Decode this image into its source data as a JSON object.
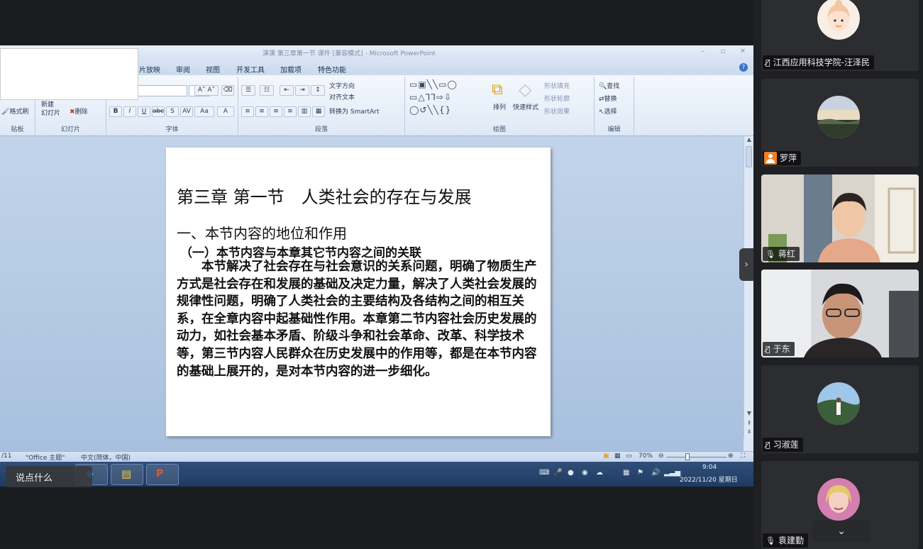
{
  "ppt": {
    "window_title": "演课 第三章第一节 课件 [兼容模式] - Microsoft PowerPoint",
    "ribbon_tabs": [
      "片放映",
      "审阅",
      "视图",
      "开发工具",
      "加载项",
      "特色功能"
    ],
    "groups": {
      "clipboard": "贴板",
      "slides": "幻灯片",
      "font": "字体",
      "paragraph": "段落",
      "drawing": "绘图",
      "editing": "编辑"
    },
    "buttons": {
      "format_painter": "格式刷",
      "new_slide": "新建\n幻灯片",
      "delete": "删除",
      "text_direction": "文字方向",
      "align_text": "对齐文本",
      "convert_smartart": "转换为 SmartArt",
      "arrange": "排列",
      "quick_styles": "快速样式",
      "shape_fill": "形状填充",
      "shape_outline": "形状轮廓",
      "shape_effects": "形状效果",
      "find": "查找",
      "replace": "替换",
      "select": "选择"
    },
    "slide": {
      "title": "第三章 第一节　人类社会的存在与发展",
      "heading": "一、本节内容的地位和作用",
      "subheading": "（一）本节内容与本章其它节内容之间的关联",
      "paragraph": "本节解决了社会存在与社会意识的关系问题，明确了物质生产方式是社会存在和发展的基础及决定力量，解决了人类社会发展的规律性问题，明确了人类社会的主要结构及各结构之间的相互关系，在全章内容中起基础性作用。本章第二节内容社会历史发展的动力，如社会基本矛盾、阶级斗争和社会革命、改革、科学技术等，第三节内容人民群众在历史发展中的作用等，都是在本节内容的基础上展开的，是对本节内容的进一步细化。"
    },
    "status": {
      "slide_count": "/11",
      "theme": "\"Office 主题\"",
      "language": "中文(简体，中国)",
      "zoom": "70%"
    }
  },
  "taskbar": {
    "say_something": "说点什么",
    "time": "9:04",
    "date": "2022/11/20 星期日"
  },
  "participants": [
    {
      "name": "江西应用科技学院-汪泽民",
      "mic": "off",
      "avatar": "cartoon-girl"
    },
    {
      "name": "罗萍",
      "mic": "none",
      "avatar": "landscape"
    },
    {
      "name": "蒋红",
      "mic": "on",
      "avatar": "video"
    },
    {
      "name": "于东",
      "mic": "off",
      "avatar": "video"
    },
    {
      "name": "习淑莲",
      "mic": "off",
      "avatar": "landscape-person"
    },
    {
      "name": "袁建勤",
      "mic": "on",
      "avatar": "woman-photo"
    }
  ],
  "colors": {
    "panel_bg": "#1f2023",
    "tile_bg": "#2c2d31",
    "ribbon_bg": "#dfe9f6",
    "taskbar_bg": "#1f3a61",
    "person_icon": "#f07f24"
  }
}
